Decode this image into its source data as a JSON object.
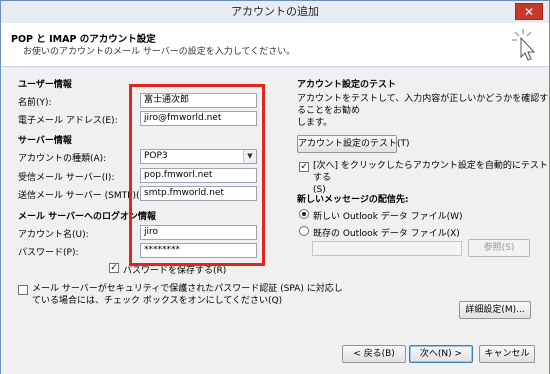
{
  "window": {
    "title": "アカウントの追加",
    "close_label": "✕"
  },
  "header": {
    "title": "POP と IMAP のアカウント設定",
    "subtitle": "お使いのアカウントのメール サーバーの設定を入力してください。"
  },
  "user_info": {
    "section": "ユーザー情報",
    "name_label": "名前(Y):",
    "name_value": "富士通次郎",
    "email_label": "電子メール アドレス(E):",
    "email_value": "jiro@fmworld.net"
  },
  "server_info": {
    "section": "サーバー情報",
    "type_label": "アカウントの種類(A):",
    "type_value": "POP3",
    "incoming_label": "受信メール サーバー(I):",
    "incoming_value": "pop.fmworl.net",
    "outgoing_label": "送信メール サーバー (SMTP)(O):",
    "outgoing_value": "smtp.fmworld.net"
  },
  "logon_info": {
    "section": "メール サーバーへのログオン情報",
    "account_label": "アカウント名(U):",
    "account_value": "jiro",
    "password_label": "パスワード(P):",
    "password_value": "********",
    "remember_label": "パスワードを保存する(R)",
    "remember_checked": "✓",
    "spa_line1": "メール サーバーがセキュリティで保護されたパスワード認証 (SPA) に対応し",
    "spa_line2": "ている場合には、チェック ボックスをオンにしてください(Q)"
  },
  "test_settings": {
    "section": "アカウント設定のテスト",
    "desc_line1": "アカウントをテストして、入力内容が正しいかどうかを確認することをお勧め",
    "desc_line2": "します。",
    "test_button": "アカウント設定のテスト(T)",
    "auto_test_line1": "[次へ] をクリックしたらアカウント設定を自動的にテストする",
    "auto_test_line2": "(S)",
    "auto_test_checked": "✓"
  },
  "delivery": {
    "section": "新しいメッセージの配信先:",
    "new_file_label": "新しい Outlook データ ファイル(W)",
    "existing_file_label": "既存の Outlook データ ファイル(X)",
    "browse_button": "参照(S)"
  },
  "buttons": {
    "more_settings": "詳細設定(M)...",
    "back": "< 戻る(B)",
    "next": "次へ(N) >",
    "cancel": "キャンセル"
  }
}
